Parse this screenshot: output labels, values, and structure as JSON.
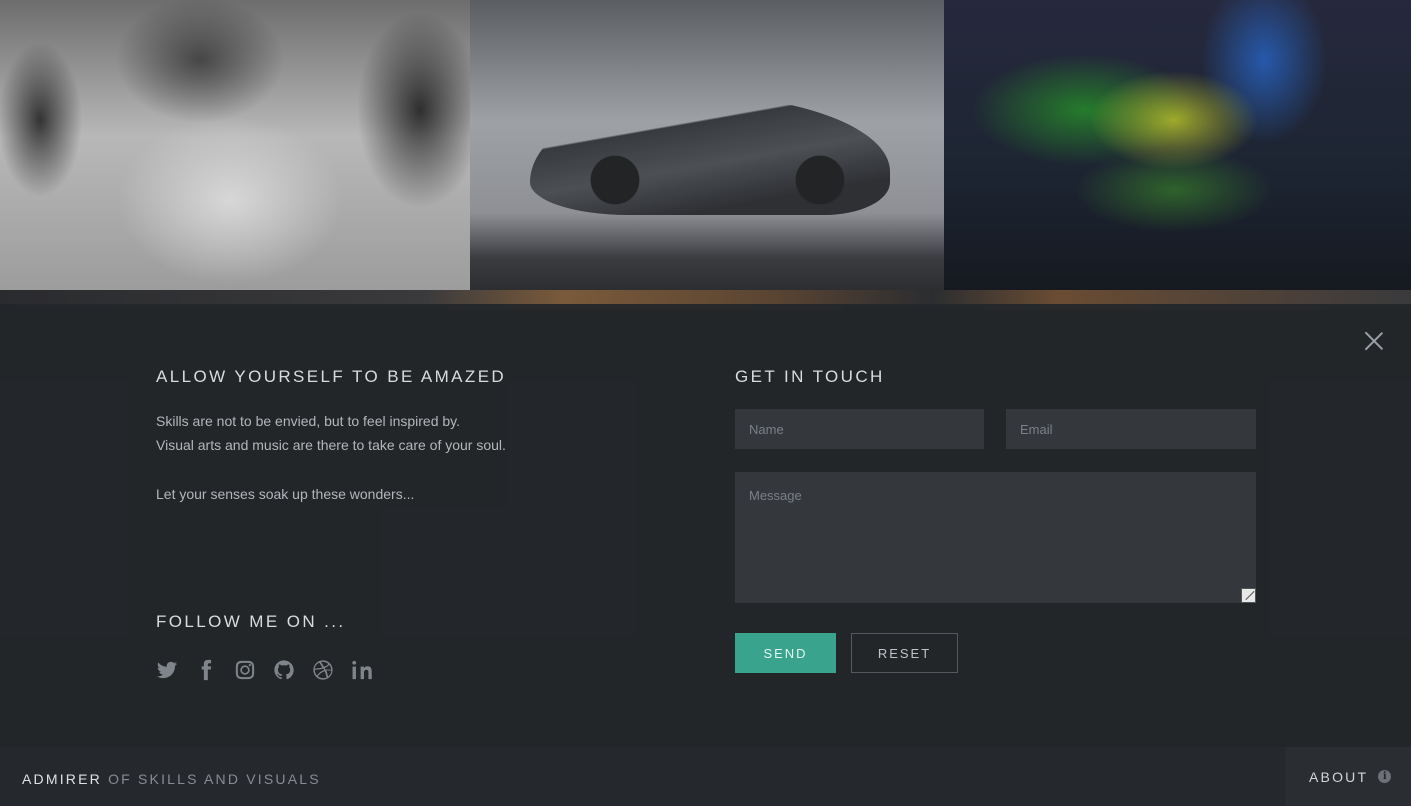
{
  "gallery": {
    "captions": [
      "",
      "",
      ""
    ]
  },
  "about_panel": {
    "title": "Allow yourself to be amazed",
    "lines": [
      "Skills are not to be envied, but to feel inspired by.",
      "Visual arts and music are there to take care of your soul."
    ],
    "closing": "Let your senses soak up these wonders...",
    "follow_title": "Follow me on ...",
    "social_icons": [
      "twitter-icon",
      "facebook-icon",
      "instagram-icon",
      "github-icon",
      "dribbble-icon",
      "linkedin-icon"
    ]
  },
  "contact": {
    "title": "Get in touch",
    "name_placeholder": "Name",
    "email_placeholder": "Email",
    "message_placeholder": "Message",
    "send_label": "Send",
    "reset_label": "Reset"
  },
  "footer": {
    "brand": "Admirer",
    "tagline": "of Skills and Visuals",
    "about_label": "About"
  },
  "colors": {
    "accent": "#39a38e",
    "panel_bg": "#23262a",
    "footer_bg": "#25282c"
  }
}
